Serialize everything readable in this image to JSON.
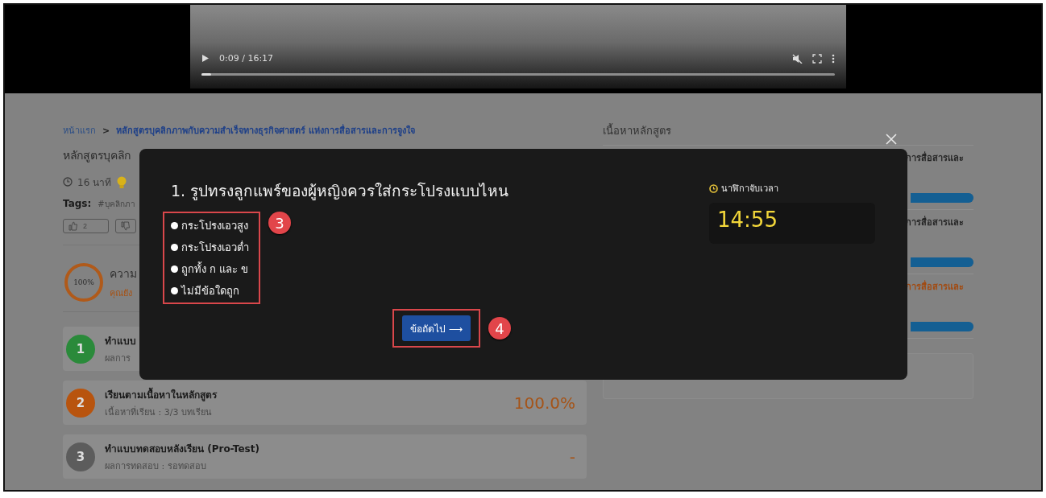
{
  "video": {
    "time": "0:09 / 16:17",
    "level": 0.015
  },
  "breadcrumb": {
    "home": "หน้าแรก",
    "separator": ">",
    "current": "หลักสูตรบุคลิกภาพกับความสำเร็จทางธุรกิจศาสตร์ แห่งการสื่อสารและการจูงใจ"
  },
  "course": {
    "title": "หลักสูตรบุคลิก",
    "duration": "16 นาที",
    "tags_label": "Tags:",
    "tag": "#บุคลิกภา",
    "likes": "2"
  },
  "progress": {
    "percent": "100%",
    "title": "ความ",
    "subtitle": "คุณยัง"
  },
  "steps": [
    {
      "number": "1",
      "title": "ทำแบบ",
      "subtitle": "ผลการ",
      "color": "#2a8a3a"
    },
    {
      "number": "2",
      "title": "เรียนตามเนื้อหาในหลักสูตร",
      "subtitle": "เนื้อหาที่เรียน : 3/3 บทเรียน",
      "result": "100.0%",
      "color": "#b8540e"
    },
    {
      "number": "3",
      "title": "ทำแบบทดสอบหลังเรียน (Pro-Test)",
      "subtitle": "ผลการทดสอบ : รอทดสอบ",
      "result": "-",
      "color": "#5c5c5c"
    }
  ],
  "sidebar": {
    "heading": "เนื้อหาหลักสูตร",
    "lessons": [
      {
        "title": "การสื่อสารและ",
        "current": false,
        "level": 1
      },
      {
        "title": "การสื่อสารและ",
        "current": false,
        "level": 1
      },
      {
        "title": "การสื่อสารและ",
        "current": true,
        "level": 1
      }
    ]
  },
  "quiz": {
    "question": "1. รูปทรงลูกแพร์ของผู้หญิงควรใส่กระโปรงแบบไหน",
    "options": [
      {
        "label": "กระโปรงเอวสูง",
        "selected": false
      },
      {
        "label": "กระโปรงเอวต่ำ",
        "selected": false
      },
      {
        "label": "ถูกทั้ง ก และ ข",
        "selected": false
      },
      {
        "label": "ไม่มีข้อใดถูก",
        "selected": false
      }
    ],
    "options_marker": "3",
    "next_button": "ข้อถัดไป ⟶",
    "button_marker": "4",
    "timer_label": "นาฬิกาจับเวลา",
    "timer": "14:55"
  }
}
